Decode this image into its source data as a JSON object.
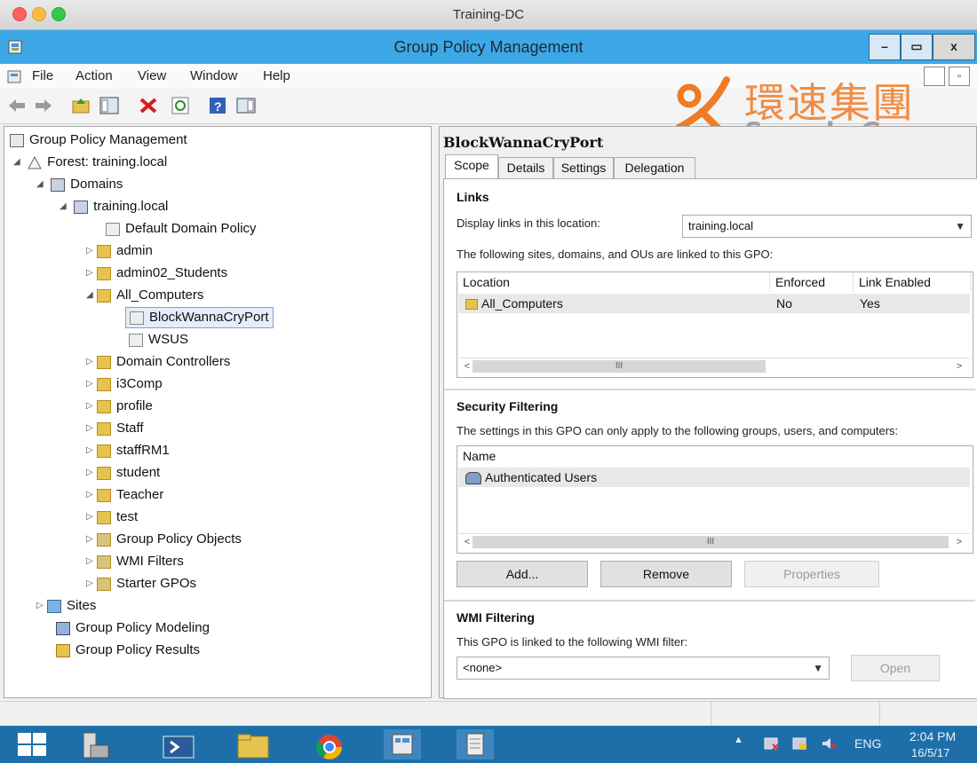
{
  "mac": {
    "title": "Training-DC"
  },
  "window": {
    "title": "Group Policy Management",
    "min": "–",
    "max": "▭",
    "close": "x"
  },
  "menu": [
    "File",
    "Action",
    "View",
    "Window",
    "Help"
  ],
  "watermark": {
    "chinese": "環速集團",
    "english": "Speedy Group"
  },
  "tree": {
    "root": "Group Policy Management",
    "forest": "Forest: training.local",
    "domains": "Domains",
    "domain": "training.local",
    "default_policy": "Default Domain Policy",
    "ous_top": [
      "admin",
      "admin02_Students"
    ],
    "all_computers": "All_Computers",
    "gpo_selected": "BlockWannaCryPort",
    "gpo_wsus": "WSUS",
    "ous_bottom": [
      "Domain Controllers",
      "i3Comp",
      "profile",
      "Staff",
      "staffRM1",
      "student",
      "Teacher",
      "test"
    ],
    "gpo_objects": "Group Policy Objects",
    "wmi_filters": "WMI Filters",
    "starter_gpos": "Starter GPOs",
    "sites": "Sites",
    "modeling": "Group Policy Modeling",
    "results": "Group Policy Results"
  },
  "details": {
    "title": "BlockWannaCryPort",
    "tabs": [
      "Scope",
      "Details",
      "Settings",
      "Delegation"
    ],
    "links": {
      "heading": "Links",
      "display_label": "Display links in this location:",
      "location_value": "training.local",
      "desc": "The following sites, domains, and OUs are linked to this GPO:",
      "columns": [
        "Location",
        "Enforced",
        "Link Enabled"
      ],
      "rows": [
        {
          "location": "All_Computers",
          "enforced": "No",
          "enabled": "Yes"
        }
      ]
    },
    "security": {
      "heading": "Security Filtering",
      "desc": "The settings in this GPO can only apply to the following groups, users, and computers:",
      "column": "Name",
      "rows": [
        "Authenticated Users"
      ],
      "add": "Add...",
      "remove": "Remove",
      "properties": "Properties"
    },
    "wmi": {
      "heading": "WMI Filtering",
      "desc": "This GPO is linked to the following WMI filter:",
      "value": "<none>",
      "open": "Open"
    }
  },
  "scroll": {
    "thumb": "III",
    "left": "<",
    "right": ">"
  },
  "taskbar": {
    "lang": "ENG",
    "time": "2:04 PM",
    "date": "16/5/17"
  },
  "colors": {
    "taskbar": "#1e6fa9",
    "titlebar": "#3ea8e6",
    "watermark": "#f07b25"
  }
}
